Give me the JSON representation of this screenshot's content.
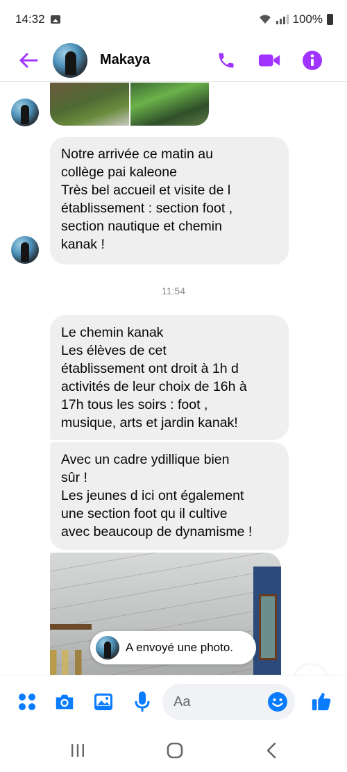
{
  "status_bar": {
    "time": "14:32",
    "battery": "100%",
    "icons": [
      "gallery-icon",
      "wifi-icon",
      "signal-icon",
      "battery-icon"
    ]
  },
  "header": {
    "contact_name": "Makaya",
    "icons": [
      "back-arrow-icon",
      "phone-icon",
      "video-icon",
      "info-icon"
    ],
    "accent_color": "#a033ff"
  },
  "messages": [
    {
      "id": "m1",
      "text": "Notre arrivée ce matin au\ncollège pai kaleone\nTrès bel accueil et visite de l\nétablissement : section foot ,\nsection nautique et chemin\nkanak !"
    },
    {
      "id": "m2",
      "text": "Le chemin kanak\nLes élèves de cet\nétablissement ont droit à 1h d\nactivités de leur choix de 16h à\n17h tous les soirs : foot ,\nmusique, arts et jardin kanak!"
    },
    {
      "id": "m3",
      "text": "Avec un cadre ydillique bien\nsûr !\nLes jeunes d ici ont également\nune section foot qu il cultive\navec beaucoup de dynamisme !"
    }
  ],
  "timestamp": "11:54",
  "toast": {
    "text": "A envoyé une photo."
  },
  "composer": {
    "placeholder": "Aa",
    "icons": [
      "menu-dots-icon",
      "camera-icon",
      "gallery-icon",
      "microphone-icon",
      "emoji-icon",
      "thumbs-up-icon"
    ],
    "icon_color": "#0a7cff"
  },
  "navbar": {
    "icons": [
      "recents-icon",
      "home-icon",
      "back-icon"
    ]
  }
}
